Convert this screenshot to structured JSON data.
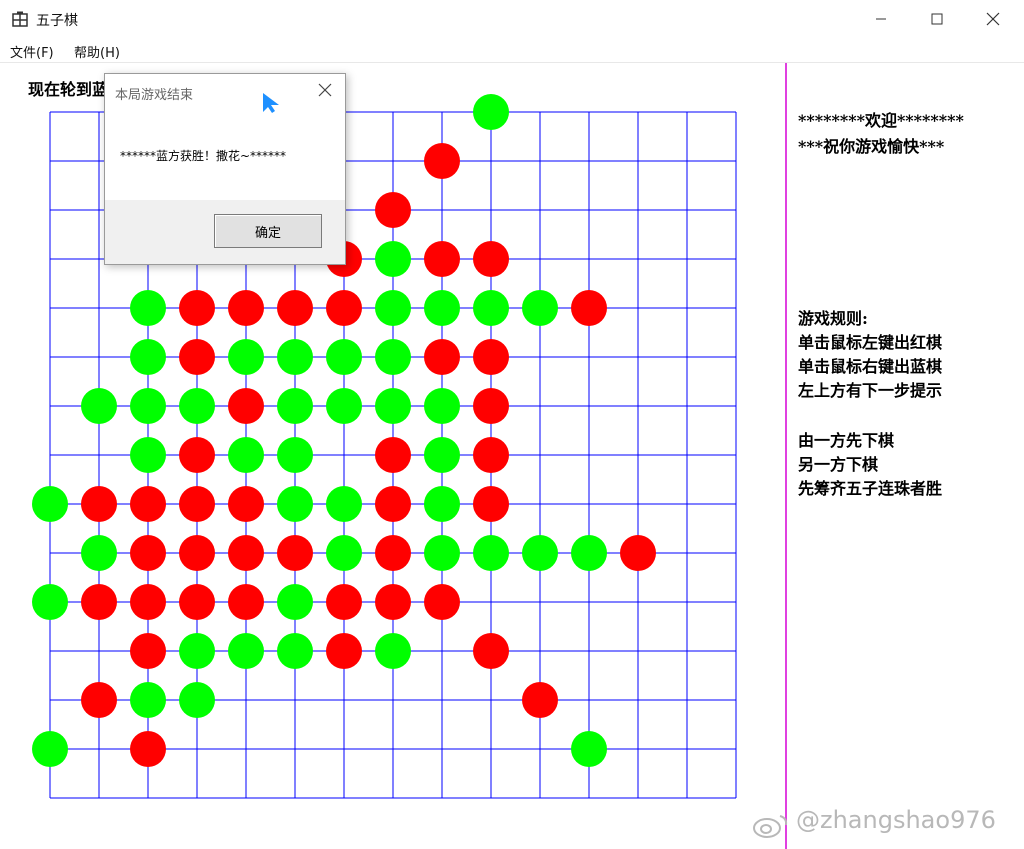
{
  "window": {
    "title": "五子棋"
  },
  "menu": [
    {
      "label": "文件(F)"
    },
    {
      "label": "帮助(H)"
    }
  ],
  "turn_text": "现在轮到蓝",
  "colors": {
    "grid": "#0000ff",
    "red": "#ff0000",
    "green": "#00ff00",
    "divider": "#e040e0"
  },
  "board": {
    "cols": 15,
    "rows": 15,
    "stones": [
      {
        "c": 9,
        "r": 0,
        "color": "green"
      },
      {
        "c": 8,
        "r": 1,
        "color": "red"
      },
      {
        "c": 7,
        "r": 2,
        "color": "red"
      },
      {
        "c": 6,
        "r": 3,
        "color": "red"
      },
      {
        "c": 7,
        "r": 3,
        "color": "green"
      },
      {
        "c": 8,
        "r": 3,
        "color": "red"
      },
      {
        "c": 9,
        "r": 3,
        "color": "red"
      },
      {
        "c": 2,
        "r": 4,
        "color": "green"
      },
      {
        "c": 3,
        "r": 4,
        "color": "red"
      },
      {
        "c": 4,
        "r": 4,
        "color": "red"
      },
      {
        "c": 5,
        "r": 4,
        "color": "red"
      },
      {
        "c": 6,
        "r": 4,
        "color": "red"
      },
      {
        "c": 7,
        "r": 4,
        "color": "green"
      },
      {
        "c": 8,
        "r": 4,
        "color": "green"
      },
      {
        "c": 9,
        "r": 4,
        "color": "green"
      },
      {
        "c": 10,
        "r": 4,
        "color": "green"
      },
      {
        "c": 11,
        "r": 4,
        "color": "red"
      },
      {
        "c": 2,
        "r": 5,
        "color": "green"
      },
      {
        "c": 3,
        "r": 5,
        "color": "red"
      },
      {
        "c": 4,
        "r": 5,
        "color": "green"
      },
      {
        "c": 5,
        "r": 5,
        "color": "green"
      },
      {
        "c": 6,
        "r": 5,
        "color": "green"
      },
      {
        "c": 7,
        "r": 5,
        "color": "green"
      },
      {
        "c": 8,
        "r": 5,
        "color": "red"
      },
      {
        "c": 9,
        "r": 5,
        "color": "red"
      },
      {
        "c": 1,
        "r": 6,
        "color": "green"
      },
      {
        "c": 2,
        "r": 6,
        "color": "green"
      },
      {
        "c": 3,
        "r": 6,
        "color": "green"
      },
      {
        "c": 4,
        "r": 6,
        "color": "red"
      },
      {
        "c": 5,
        "r": 6,
        "color": "green"
      },
      {
        "c": 6,
        "r": 6,
        "color": "green"
      },
      {
        "c": 7,
        "r": 6,
        "color": "green"
      },
      {
        "c": 8,
        "r": 6,
        "color": "green"
      },
      {
        "c": 9,
        "r": 6,
        "color": "red"
      },
      {
        "c": 2,
        "r": 7,
        "color": "green"
      },
      {
        "c": 3,
        "r": 7,
        "color": "red"
      },
      {
        "c": 4,
        "r": 7,
        "color": "green"
      },
      {
        "c": 5,
        "r": 7,
        "color": "green"
      },
      {
        "c": 7,
        "r": 7,
        "color": "red"
      },
      {
        "c": 8,
        "r": 7,
        "color": "green"
      },
      {
        "c": 9,
        "r": 7,
        "color": "red"
      },
      {
        "c": 0,
        "r": 8,
        "color": "green"
      },
      {
        "c": 1,
        "r": 8,
        "color": "red"
      },
      {
        "c": 2,
        "r": 8,
        "color": "red"
      },
      {
        "c": 3,
        "r": 8,
        "color": "red"
      },
      {
        "c": 4,
        "r": 8,
        "color": "red"
      },
      {
        "c": 5,
        "r": 8,
        "color": "green"
      },
      {
        "c": 6,
        "r": 8,
        "color": "green"
      },
      {
        "c": 7,
        "r": 8,
        "color": "red"
      },
      {
        "c": 8,
        "r": 8,
        "color": "green"
      },
      {
        "c": 9,
        "r": 8,
        "color": "red"
      },
      {
        "c": 1,
        "r": 9,
        "color": "green"
      },
      {
        "c": 2,
        "r": 9,
        "color": "red"
      },
      {
        "c": 3,
        "r": 9,
        "color": "red"
      },
      {
        "c": 4,
        "r": 9,
        "color": "red"
      },
      {
        "c": 5,
        "r": 9,
        "color": "red"
      },
      {
        "c": 6,
        "r": 9,
        "color": "green"
      },
      {
        "c": 7,
        "r": 9,
        "color": "red"
      },
      {
        "c": 8,
        "r": 9,
        "color": "green"
      },
      {
        "c": 9,
        "r": 9,
        "color": "green"
      },
      {
        "c": 10,
        "r": 9,
        "color": "green"
      },
      {
        "c": 11,
        "r": 9,
        "color": "green"
      },
      {
        "c": 12,
        "r": 9,
        "color": "red"
      },
      {
        "c": 0,
        "r": 10,
        "color": "green"
      },
      {
        "c": 1,
        "r": 10,
        "color": "red"
      },
      {
        "c": 2,
        "r": 10,
        "color": "red"
      },
      {
        "c": 3,
        "r": 10,
        "color": "red"
      },
      {
        "c": 4,
        "r": 10,
        "color": "red"
      },
      {
        "c": 5,
        "r": 10,
        "color": "green"
      },
      {
        "c": 6,
        "r": 10,
        "color": "red"
      },
      {
        "c": 7,
        "r": 10,
        "color": "red"
      },
      {
        "c": 8,
        "r": 10,
        "color": "red"
      },
      {
        "c": 2,
        "r": 11,
        "color": "red"
      },
      {
        "c": 3,
        "r": 11,
        "color": "green"
      },
      {
        "c": 4,
        "r": 11,
        "color": "green"
      },
      {
        "c": 5,
        "r": 11,
        "color": "green"
      },
      {
        "c": 6,
        "r": 11,
        "color": "red"
      },
      {
        "c": 7,
        "r": 11,
        "color": "green"
      },
      {
        "c": 9,
        "r": 11,
        "color": "red"
      },
      {
        "c": 1,
        "r": 12,
        "color": "red"
      },
      {
        "c": 2,
        "r": 12,
        "color": "green"
      },
      {
        "c": 3,
        "r": 12,
        "color": "green"
      },
      {
        "c": 10,
        "r": 12,
        "color": "red"
      },
      {
        "c": 0,
        "r": 13,
        "color": "green"
      },
      {
        "c": 2,
        "r": 13,
        "color": "red"
      },
      {
        "c": 11,
        "r": 13,
        "color": "green"
      }
    ]
  },
  "sidebar": {
    "welcome_line1": "********欢迎********",
    "welcome_line2": "***祝你游戏愉快***",
    "rules_title": "游戏规则:",
    "rules_line1": "单击鼠标左键出红棋",
    "rules_line2": "单击鼠标右键出蓝棋",
    "rules_line3": "左上方有下一步提示",
    "rules_line4": "由一方先下棋",
    "rules_line5": "另一方下棋",
    "rules_line6": "先筹齐五子连珠者胜"
  },
  "dialog": {
    "title": "本局游戏结束",
    "message": "******蓝方获胜！撒花~******",
    "ok_label": "确定"
  },
  "watermark": "@zhangshao976"
}
